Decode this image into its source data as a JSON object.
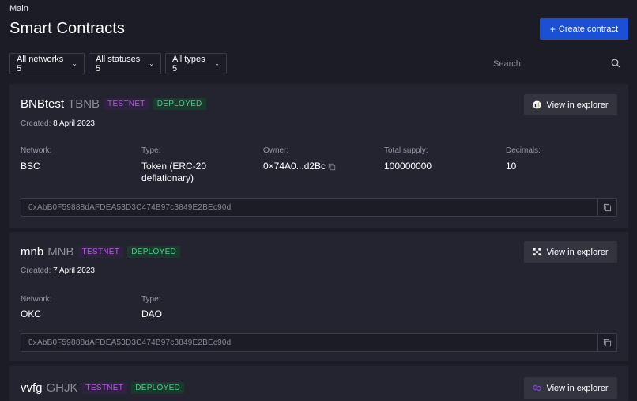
{
  "breadcrumb": "Main",
  "page_title": "Smart Contracts",
  "create_button": {
    "plus": "+",
    "label": "Create contract"
  },
  "filters": [
    {
      "label": "All networks 5"
    },
    {
      "label": "All statuses 5"
    },
    {
      "label": "All types 5"
    }
  ],
  "search": {
    "placeholder": "Search"
  },
  "colors": {
    "accent": "#1a4fd6",
    "testnet": "#b15be0",
    "deployed": "#4cc98a",
    "background": "#1c1c26",
    "card": "#242430"
  },
  "contracts": [
    {
      "name": "BNBtest",
      "symbol": "TBNB",
      "network_badge": "TESTNET",
      "status_badge": "DEPLOYED",
      "explorer_label": "View in explorer",
      "explorer_icon": "bscscan-icon",
      "created_label": "Created:",
      "created_date": "8 April 2023",
      "fields": {
        "network_label": "Network:",
        "network": "BSC",
        "type_label": "Type:",
        "type": "Token (ERC-20 deflationary)",
        "owner_label": "Owner:",
        "owner": "0×74A0...d2Bc",
        "supply_label": "Total supply:",
        "supply": "100000000",
        "decimals_label": "Decimals:",
        "decimals": "10"
      },
      "address": "0xAbB0F59888dAFDEA53D3C474B97c3849E2BEc90d"
    },
    {
      "name": "mnb",
      "symbol": "MNB",
      "network_badge": "TESTNET",
      "status_badge": "DEPLOYED",
      "explorer_label": "View in explorer",
      "explorer_icon": "okx-icon",
      "created_label": "Created:",
      "created_date": "7 April 2023",
      "fields": {
        "network_label": "Network:",
        "network": "OKC",
        "type_label": "Type:",
        "type": "DAO"
      },
      "address": "0xAbB0F59888dAFDEA53D3C474B97c3849E2BEc90d"
    },
    {
      "name": "vvfg",
      "symbol": "GHJK",
      "network_badge": "TESTNET",
      "status_badge": "DEPLOYED",
      "explorer_label": "View in explorer",
      "explorer_icon": "polygon-icon"
    }
  ]
}
